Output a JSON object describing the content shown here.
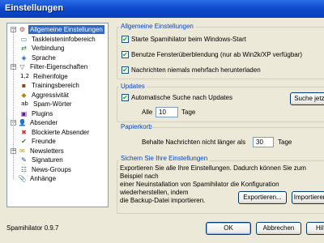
{
  "window": {
    "title": "Einstellungen"
  },
  "tree": {
    "items": [
      {
        "label": "Allgemeine Einstellungen",
        "icon": "settings-icon",
        "level": 0,
        "expander": "−",
        "selected": true
      },
      {
        "label": "Taskleisteninfobereich",
        "icon": "tray-icon",
        "level": 1
      },
      {
        "label": "Verbindung",
        "icon": "connection-icon",
        "level": 1
      },
      {
        "label": "Sprache",
        "icon": "language-icon",
        "level": 1
      },
      {
        "label": "Filter-Eigenschaften",
        "icon": "filter-icon",
        "level": 0,
        "expander": "−"
      },
      {
        "label": "Reihenfolge",
        "icon": "order-icon",
        "level": 1,
        "glyph": "1,2"
      },
      {
        "label": "Trainingsbereich",
        "icon": "training-icon",
        "level": 1
      },
      {
        "label": "Aggressivität",
        "icon": "aggressivity-icon",
        "level": 1
      },
      {
        "label": "Spam-Wörter",
        "icon": "spam-words-icon",
        "level": 1,
        "glyph": "ab"
      },
      {
        "label": "Plugins",
        "icon": "plugins-icon",
        "level": 1
      },
      {
        "label": "Absender",
        "icon": "sender-icon",
        "level": 0,
        "expander": "−"
      },
      {
        "label": "Blockierte Absender",
        "icon": "blocked-icon",
        "level": 1
      },
      {
        "label": "Freunde",
        "icon": "friends-icon",
        "level": 1
      },
      {
        "label": "Newsletters",
        "icon": "newsletters-icon",
        "level": 0,
        "expander": "−"
      },
      {
        "label": "Signaturen",
        "icon": "signatures-icon",
        "level": 1
      },
      {
        "label": "News-Groups",
        "icon": "newsgroups-icon",
        "level": 1
      },
      {
        "label": "Anhänge",
        "icon": "attachments-icon",
        "level": 0
      }
    ]
  },
  "general": {
    "title": "Allgemeine Einstellungen",
    "start_label": "Starte Spamihilator beim Windows-Start",
    "transparency_label": "Benutze Fensterüberblendung (nur ab Win2k/XP verfügbar)",
    "download_label": "Nachrichten niemals mehrfach herunterladen"
  },
  "updates": {
    "title": "Updates",
    "auto_label": "Automatische Suche nach Updates",
    "every_label": "Alle",
    "days_value": "10",
    "days_label": "Tage",
    "search_button": "Suche jetzt"
  },
  "trash": {
    "title": "Papierkorb",
    "keep_label": "Behalte Nachrichten nicht länger als",
    "days_value": "30",
    "days_label": "Tage"
  },
  "backup": {
    "title": "Sichern Sie Ihre Einstellungen",
    "line1": "Exportieren Sie alle Ihre Einstellungen. Dadurch können Sie zum Beispiel nach",
    "line2": "einer Neuinstallation von Spamihilator die Konfiguration wiederherstellen, indem",
    "line3": "die Backup-Datei importieren.",
    "export_button": "Exportieren...",
    "import_button": "Importieren"
  },
  "footer": {
    "version": "Spamihilator 0.9.7",
    "ok": "OK",
    "cancel": "Abbrechen",
    "help": "Hilfe"
  }
}
